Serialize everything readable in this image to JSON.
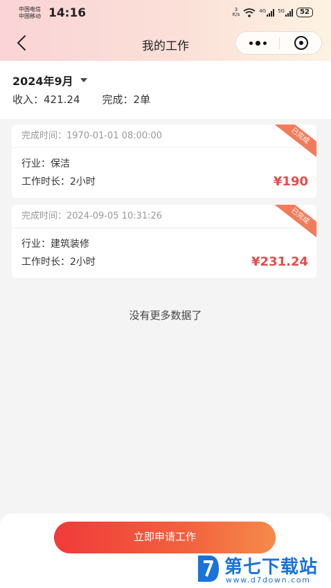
{
  "status_bar": {
    "carrier_1": "中国电信",
    "carrier_2": "中国移动",
    "time": "14:16",
    "net_speed": "3\nK/s",
    "sim1_label": "4G",
    "sim2_label": "5G",
    "battery": "52"
  },
  "navbar": {
    "title": "我的工作",
    "back_icon": "chevron-left-icon",
    "more_icon": "more-dots-icon",
    "close_icon": "target-circle-icon"
  },
  "summary": {
    "month": "2024年9月",
    "income_label": "收入：",
    "income_value": "421.24",
    "completed_label": "完成：",
    "completed_value": "2单"
  },
  "jobs": [
    {
      "completed_time": "完成时间：1970-01-01 08:00:00",
      "industry": "行业：保洁",
      "duration": "工作时长：2小时",
      "price": "¥190",
      "status": "已完成"
    },
    {
      "completed_time": "完成时间：2024-09-05 10:31:26",
      "industry": "行业：建筑装修",
      "duration": "工作时长：2小时",
      "price": "¥231.24",
      "status": "已完成"
    }
  ],
  "no_more_text": "没有更多数据了",
  "apply_button": "立即申请工作",
  "watermark": {
    "title": "第七下载站",
    "url": "www.d7down.com"
  },
  "colors": {
    "accent_red": "#e84a4a",
    "ribbon": "#f27c5a",
    "watermark_blue": "#1a73d9"
  }
}
